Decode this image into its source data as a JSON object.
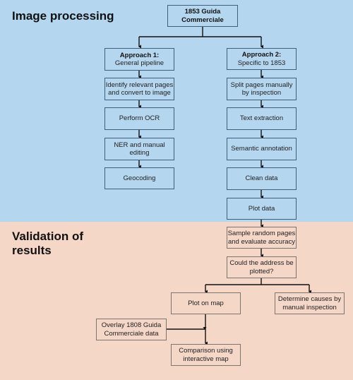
{
  "sections": {
    "image_processing": "Image processing",
    "validation": "Validation of results"
  },
  "nodes": {
    "source": "1853 Guida Commerciale",
    "approach1_title": "Approach 1:",
    "approach1_sub": "General pipeline",
    "a1_step1": "Identify relevant pages and convert to image",
    "a1_step2": "Perform OCR",
    "a1_step3": "NER and manual editing",
    "a1_step4": "Geocoding",
    "approach2_title": "Approach 2:",
    "approach2_sub": "Specific to 1853",
    "a2_step1": "Split pages manually by inspection",
    "a2_step2": "Text extraction",
    "a2_step3": "Semantic annotation",
    "a2_step4": "Clean data",
    "a2_step5": "Plot data",
    "v_step1": "Sample random pages and evaluate accuracy",
    "v_step2": "Could the address be plotted?",
    "v_yes": "Plot on map",
    "v_no": "Determine causes by manual inspection",
    "overlay": "Overlay 1808 Guida Commerciale data",
    "comparison": "Comparison using interactive map"
  }
}
